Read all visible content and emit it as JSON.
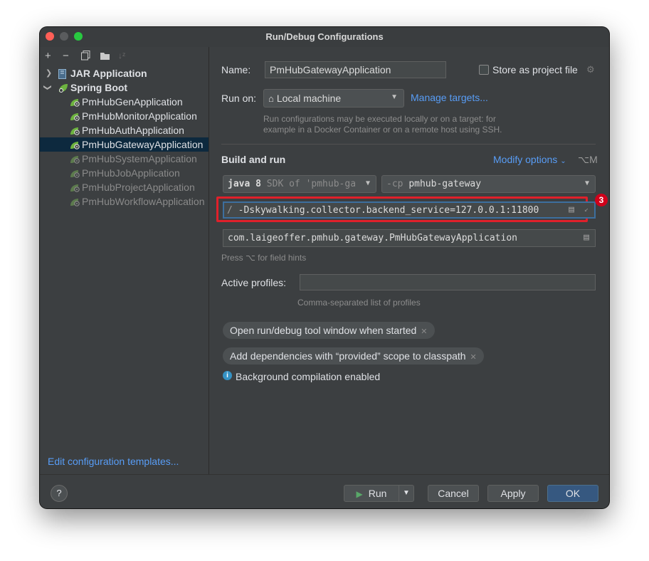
{
  "window": {
    "title": "Run/Debug Configurations"
  },
  "sidebar": {
    "toolbar": [
      "add-icon",
      "remove-icon",
      "copy-icon",
      "new-folder-icon",
      "sort-icon"
    ],
    "groups": [
      {
        "label": "JAR Application",
        "expanded": false
      },
      {
        "label": "Spring Boot",
        "expanded": true
      }
    ],
    "items": [
      {
        "label": "PmHubGenApplication",
        "active": true
      },
      {
        "label": "PmHubMonitorApplication",
        "active": true
      },
      {
        "label": "PmHubAuthApplication",
        "active": true
      },
      {
        "label": "PmHubGatewayApplication",
        "active": true,
        "selected": true
      },
      {
        "label": "PmHubSystemApplication",
        "active": false
      },
      {
        "label": "PmHubJobApplication",
        "active": false
      },
      {
        "label": "PmHubProjectApplication",
        "active": false
      },
      {
        "label": "PmHubWorkflowApplication",
        "active": false
      }
    ],
    "edit_templates": "Edit configuration templates..."
  },
  "form": {
    "name_label": "Name:",
    "name_value": "PmHubGatewayApplication",
    "store_label": "Store as project file",
    "run_on_label": "Run on:",
    "run_on_value": "Local machine",
    "manage_targets": "Manage targets...",
    "run_on_hint_1": "Run configurations may be executed locally or on a target: for",
    "run_on_hint_2": "example in a Docker Container or on a remote host using SSH.",
    "build_and_run": "Build and run",
    "modify_options": "Modify options",
    "modify_shortcut": "⌥M",
    "sdk_bold": "java 8",
    "sdk_rest": " SDK of 'pmhub-ga",
    "cp_prefix": "-cp",
    "cp_value": "pmhub-gateway",
    "vm_options_lead": "/",
    "vm_options": "-Dskywalking.collector.backend_service=127.0.0.1:11800",
    "badge": "3",
    "main_class": "com.laigeoffer.pmhub.gateway.PmHubGatewayApplication",
    "field_hint": "Press ⌥ for field hints",
    "active_profiles_label": "Active profiles:",
    "active_profiles_value": "",
    "active_profiles_hint": "Comma-separated list of profiles",
    "chip1": "Open run/debug tool window when started",
    "chip2": "Add dependencies with “provided” scope to classpath",
    "bg_compile": "Background compilation enabled"
  },
  "buttons": {
    "help": "?",
    "run": "Run",
    "cancel": "Cancel",
    "apply": "Apply",
    "ok": "OK"
  },
  "colors": {
    "accent": "#589df6",
    "highlight": "#e0202a",
    "selected": "#0d293e",
    "primary": "#365880"
  }
}
